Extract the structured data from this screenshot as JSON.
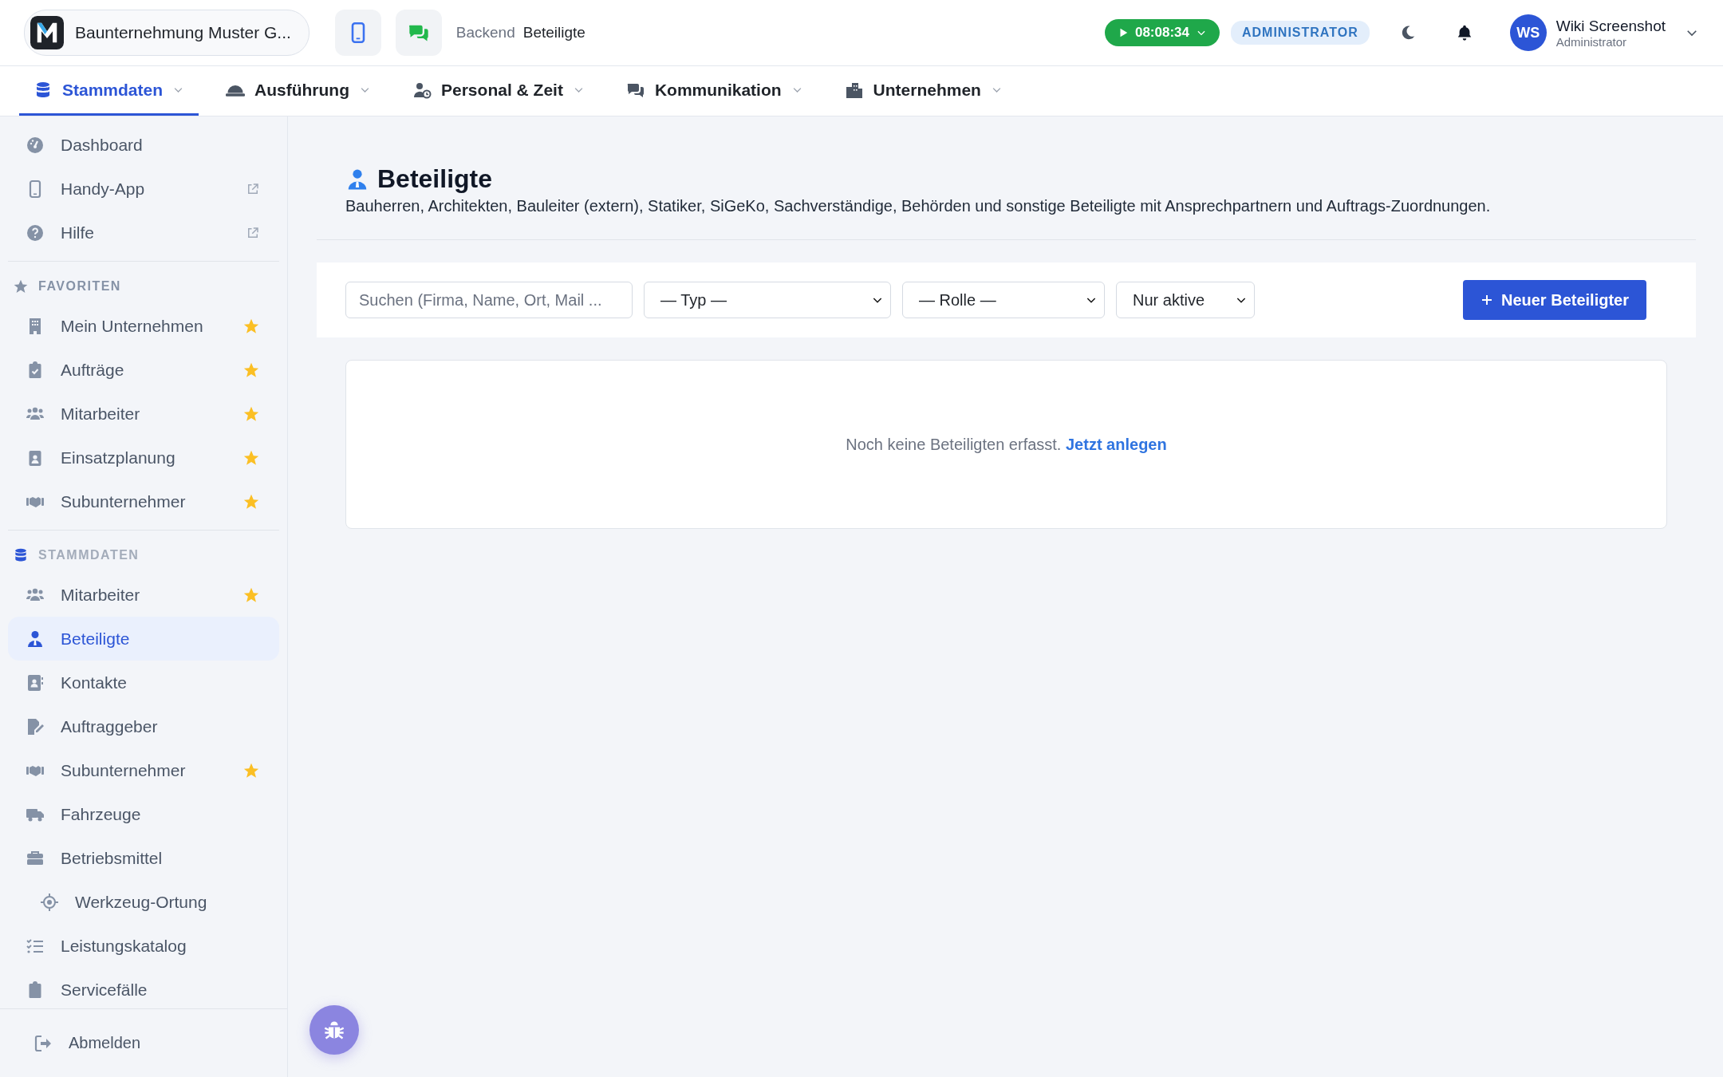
{
  "topbar": {
    "company": "Baunternehmung Muster G...",
    "breadcrumb": [
      "Backend",
      "Beteiligte"
    ],
    "timer": "08:08:34",
    "role_badge": "ADMINISTRATOR",
    "user": {
      "initials": "WS",
      "name": "Wiki Screenshot",
      "role": "Administrator"
    }
  },
  "nav_tabs": [
    {
      "label": "Stammdaten",
      "selected": true
    },
    {
      "label": "Ausführung",
      "selected": false
    },
    {
      "label": "Personal & Zeit",
      "selected": false
    },
    {
      "label": "Kommunikation",
      "selected": false
    },
    {
      "label": "Unternehmen",
      "selected": false
    }
  ],
  "sidebar": {
    "top_items": [
      {
        "label": "Dashboard",
        "external": false
      },
      {
        "label": "Handy-App",
        "external": true
      },
      {
        "label": "Hilfe",
        "external": true
      }
    ],
    "sections": [
      {
        "title": "FAVORITEN",
        "kind": "favorites",
        "items": [
          {
            "label": "Mein Unternehmen",
            "starred": true,
            "selected": false
          },
          {
            "label": "Aufträge",
            "starred": true,
            "selected": false
          },
          {
            "label": "Mitarbeiter",
            "starred": true,
            "selected": false
          },
          {
            "label": "Einsatzplanung",
            "starred": true,
            "selected": false
          },
          {
            "label": "Subunternehmer",
            "starred": true,
            "selected": false
          }
        ]
      },
      {
        "title": "STAMMDATEN",
        "kind": "category",
        "items": [
          {
            "label": "Mitarbeiter",
            "starred": true,
            "selected": false
          },
          {
            "label": "Beteiligte",
            "starred": false,
            "selected": true
          },
          {
            "label": "Kontakte",
            "starred": false,
            "selected": false
          },
          {
            "label": "Auftraggeber",
            "starred": false,
            "selected": false
          },
          {
            "label": "Subunternehmer",
            "starred": true,
            "selected": false
          },
          {
            "label": "Fahrzeuge",
            "starred": false,
            "selected": false
          },
          {
            "label": "Betriebsmittel",
            "starred": false,
            "selected": false,
            "children": [
              {
                "label": "Werkzeug-Ortung",
                "starred": false,
                "selected": false
              }
            ]
          },
          {
            "label": "Leistungskatalog",
            "starred": false,
            "selected": false
          },
          {
            "label": "Servicefälle",
            "starred": false,
            "selected": false
          }
        ]
      }
    ],
    "footer": {
      "label": "Abmelden"
    }
  },
  "page": {
    "title": "Beteiligte",
    "description": "Bauherren, Architekten, Bauleiter (extern), Statiker, SiGeKo, Sachverständige, Behörden und sonstige Beteiligte mit Ansprechpartnern und Auftrags-Zuordnungen.",
    "filters": {
      "search": {
        "placeholder": "Suchen (Firma, Name, Ort, Mail ..."
      },
      "selects": [
        {
          "value": "— Typ —"
        },
        {
          "value": "— Rolle —"
        },
        {
          "value": "Nur aktive"
        }
      ]
    },
    "new_button": "Neuer Beteiligter",
    "empty_state": {
      "text": "Noch keine Beteiligten erfasst.",
      "link": "Jetzt anlegen"
    }
  }
}
